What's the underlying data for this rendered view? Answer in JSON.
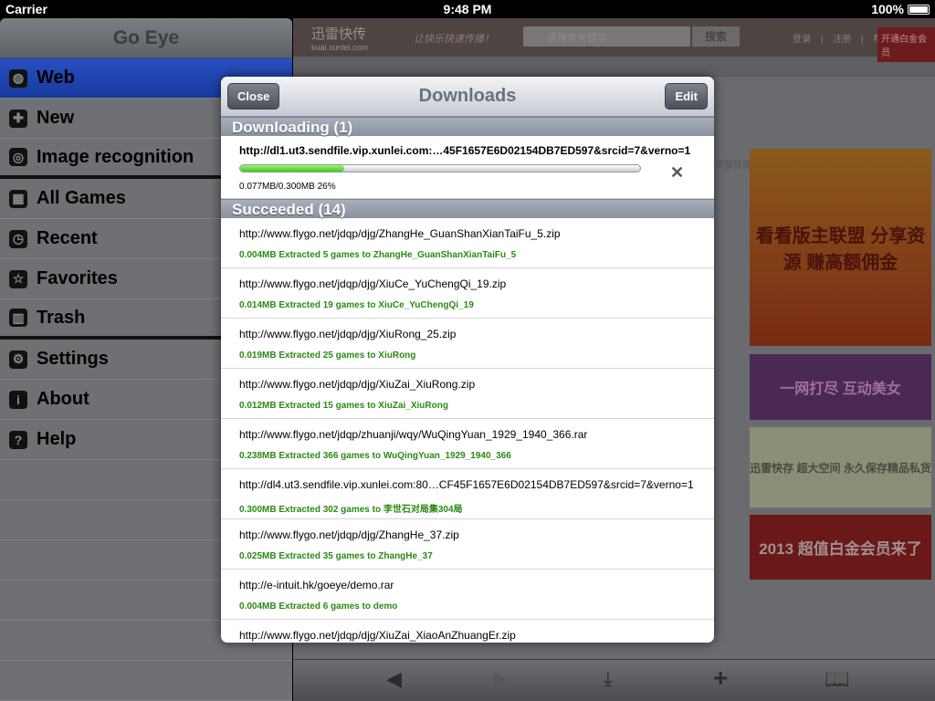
{
  "status": {
    "carrier": "Carrier",
    "time": "9:48 PM",
    "battery": "100%"
  },
  "sidebar": {
    "title": "Go Eye",
    "items": [
      {
        "label": "Web",
        "icon": "globe-icon",
        "glyph": "◍"
      },
      {
        "label": "New",
        "icon": "plus-icon",
        "glyph": "✚"
      },
      {
        "label": "Image recognition",
        "icon": "camera-target-icon",
        "glyph": "◎"
      },
      {
        "label": "All Games",
        "icon": "grid-icon",
        "glyph": "▦"
      },
      {
        "label": "Recent",
        "icon": "clock-icon",
        "glyph": "◷"
      },
      {
        "label": "Favorites",
        "icon": "star-icon",
        "glyph": "☆"
      },
      {
        "label": "Trash",
        "icon": "trash-icon",
        "glyph": "▥"
      },
      {
        "label": "Settings",
        "icon": "gear-icon",
        "glyph": "⚙"
      },
      {
        "label": "About",
        "icon": "info-icon",
        "glyph": "i"
      },
      {
        "label": "Help",
        "icon": "help-icon",
        "glyph": "?"
      }
    ]
  },
  "web": {
    "logo": "迅雷快传",
    "logo_sub": "kuai.xunlei.com",
    "slogan": "让快乐快速传播！",
    "search_placeholder": "请搜索关键字",
    "search_button": "搜索",
    "links": "登录 | 注册 | 帮助",
    "vip": "开通白金会员",
    "side_text": "举报资源",
    "ads": [
      "看看版主联盟 分享资源 赚高额佣金",
      "一网打尽 互动美女",
      "迅雷快存 超大空间 永久保存精品私货",
      "2013 超值白金会员来了"
    ]
  },
  "toolbar": {
    "back": "◀",
    "forward": "▶",
    "download": "⤓",
    "add": "+",
    "bookmarks": "📖"
  },
  "modal": {
    "title": "Downloads",
    "close": "Close",
    "edit": "Edit",
    "downloading_header": "Downloading (1)",
    "downloading": {
      "url": "http://dl1.ut3.sendfile.vip.xunlei.com:…45F1657E6D02154DB7ED597&srcid=7&verno=1",
      "progress_text": "0.077MB/0.300MB 26%",
      "progress": 0.26
    },
    "succeeded_header": "Succeeded (14)",
    "succeeded": [
      {
        "url": "http://www.flygo.net/jdqp/djg/ZhangHe_GuanShanXianTaiFu_5.zip",
        "info": "0.004MB Extracted 5 games to ZhangHe_GuanShanXianTaiFu_5"
      },
      {
        "url": "http://www.flygo.net/jdqp/djg/XiuCe_YuChengQi_19.zip",
        "info": "0.014MB Extracted 19 games to XiuCe_YuChengQi_19"
      },
      {
        "url": "http://www.flygo.net/jdqp/djg/XiuRong_25.zip",
        "info": "0.019MB Extracted 25 games to XiuRong"
      },
      {
        "url": "http://www.flygo.net/jdqp/djg/XiuZai_XiuRong.zip",
        "info": "0.012MB Extracted 15 games to XiuZai_XiuRong"
      },
      {
        "url": "http://www.flygo.net/jdqp/zhuanji/wqy/WuQingYuan_1929_1940_366.rar",
        "info": "0.238MB Extracted 366 games to WuQingYuan_1929_1940_366"
      },
      {
        "url": "http://dl4.ut3.sendfile.vip.xunlei.com:80…CF45F1657E6D02154DB7ED597&srcid=7&verno=1",
        "info": "0.300MB Extracted 302 games to 李世石对局集304局"
      },
      {
        "url": "http://www.flygo.net/jdqp/djg/ZhangHe_37.zip",
        "info": "0.025MB Extracted 35 games to ZhangHe_37"
      },
      {
        "url": "http://e-intuit.hk/goeye/demo.rar",
        "info": "0.004MB Extracted 6 games to demo"
      },
      {
        "url": "http://www.flygo.net/jdqp/djg/XiuZai_XiaoAnZhuangEr.zip",
        "info": ""
      }
    ]
  }
}
